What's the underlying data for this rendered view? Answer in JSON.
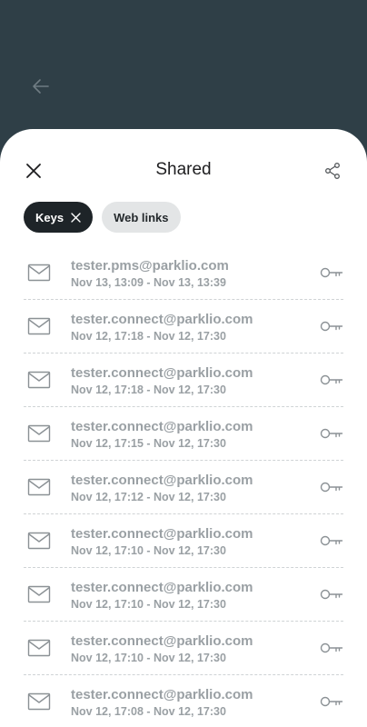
{
  "header": {
    "title": "Shared"
  },
  "filters": [
    {
      "label": "Keys",
      "active": true
    },
    {
      "label": "Web links",
      "active": false
    }
  ],
  "shares": [
    {
      "email": "tester.pms@parklio.com",
      "period": "Nov 13, 13:09 - Nov 13, 13:39"
    },
    {
      "email": "tester.connect@parklio.com",
      "period": "Nov 12, 17:18 - Nov 12, 17:30"
    },
    {
      "email": "tester.connect@parklio.com",
      "period": "Nov 12, 17:18 - Nov 12, 17:30"
    },
    {
      "email": "tester.connect@parklio.com",
      "period": "Nov 12, 17:15 - Nov 12, 17:30"
    },
    {
      "email": "tester.connect@parklio.com",
      "period": "Nov 12, 17:12 - Nov 12, 17:30"
    },
    {
      "email": "tester.connect@parklio.com",
      "period": "Nov 12, 17:10 - Nov 12, 17:30"
    },
    {
      "email": "tester.connect@parklio.com",
      "period": "Nov 12, 17:10 - Nov 12, 17:30"
    },
    {
      "email": "tester.connect@parklio.com",
      "period": "Nov 12, 17:10 - Nov 12, 17:30"
    },
    {
      "email": "tester.connect@parklio.com",
      "period": "Nov 12, 17:08 - Nov 12, 17:30"
    }
  ],
  "icons": {
    "back": "arrow-left-icon",
    "close": "close-icon",
    "share": "share-icon",
    "chip_remove": "close-icon",
    "row_leading": "envelope-icon",
    "row_trailing": "key-icon"
  },
  "colors": {
    "background": "#2f3f47",
    "sheet": "#ffffff",
    "chip_active": "#1e2428",
    "chip_inactive": "#e3e5e6",
    "muted_text": "#9aa0a4"
  }
}
